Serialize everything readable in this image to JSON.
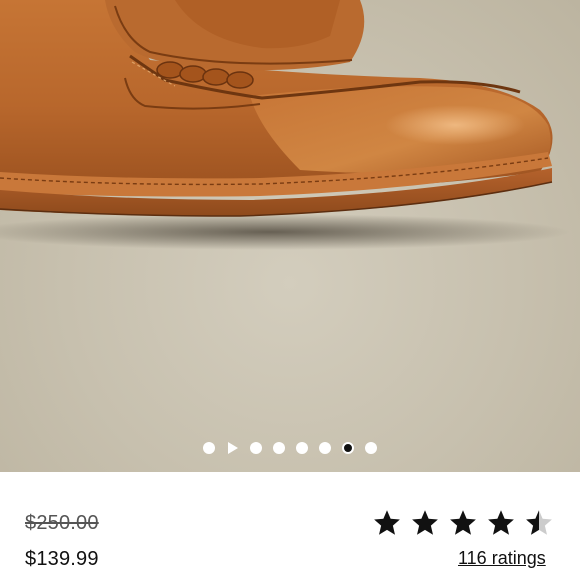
{
  "product": {
    "image": {
      "name": "leather-penny-loafer",
      "background_color": "#c9c2b0",
      "leather_color": "#b8682e"
    },
    "carousel": {
      "total_slides": 8,
      "active_slide": 7,
      "has_video": true
    },
    "pricing": {
      "original_price": "$250.00",
      "sale_price": "$139.99"
    },
    "rating": {
      "stars": 4.5,
      "max_stars": 5,
      "ratings_label": "116 ratings"
    }
  }
}
